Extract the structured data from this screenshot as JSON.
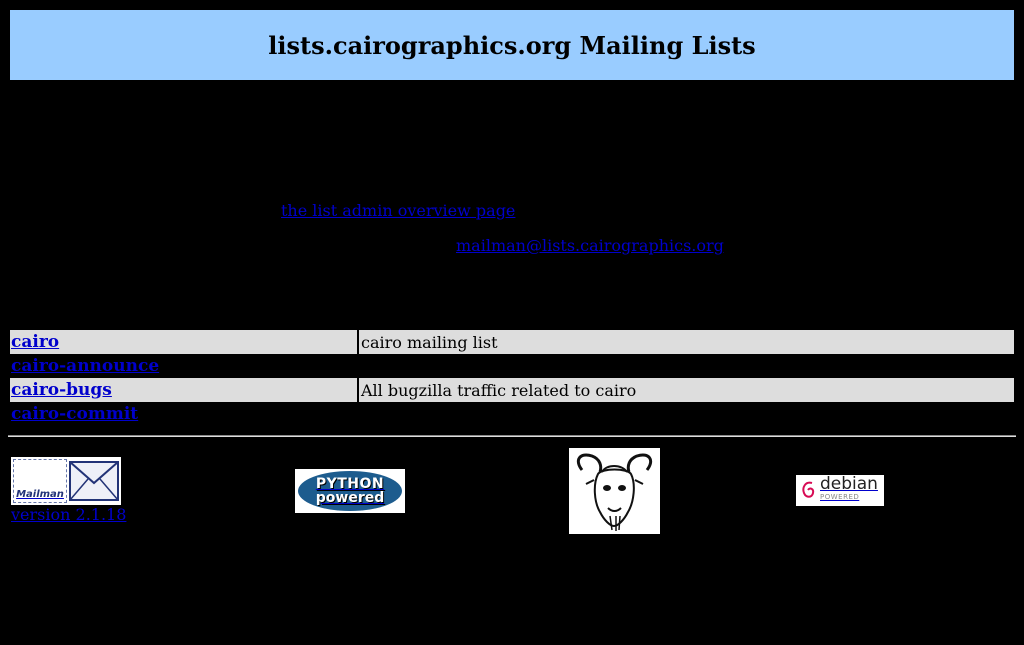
{
  "page": {
    "title": "lists.cairographics.org Mailing Lists",
    "header_bg": "#99ccff",
    "background": "#000000",
    "link_color": "#0000cc"
  },
  "intro": {
    "admin_link": "the list admin overview page",
    "contact_link": "mailman@lists.cairographics.org"
  },
  "lists": [
    {
      "name": "cairo",
      "description": "cairo mailing list"
    },
    {
      "name": "cairo-announce",
      "description": ""
    },
    {
      "name": "cairo-bugs",
      "description": "All bugzilla traffic related to cairo"
    },
    {
      "name": "cairo-commit",
      "description": ""
    }
  ],
  "footer": {
    "mailman_logo_text": "Mailman",
    "version_link": "version 2.1.18",
    "python_logo_line1": "PYTHON",
    "python_logo_line2": "powered",
    "debian_logo_line1": "debian",
    "debian_logo_line2": "POWERED",
    "icons": [
      "mailman-logo",
      "python-powered-logo",
      "gnu-head-logo",
      "debian-powered-logo"
    ]
  }
}
